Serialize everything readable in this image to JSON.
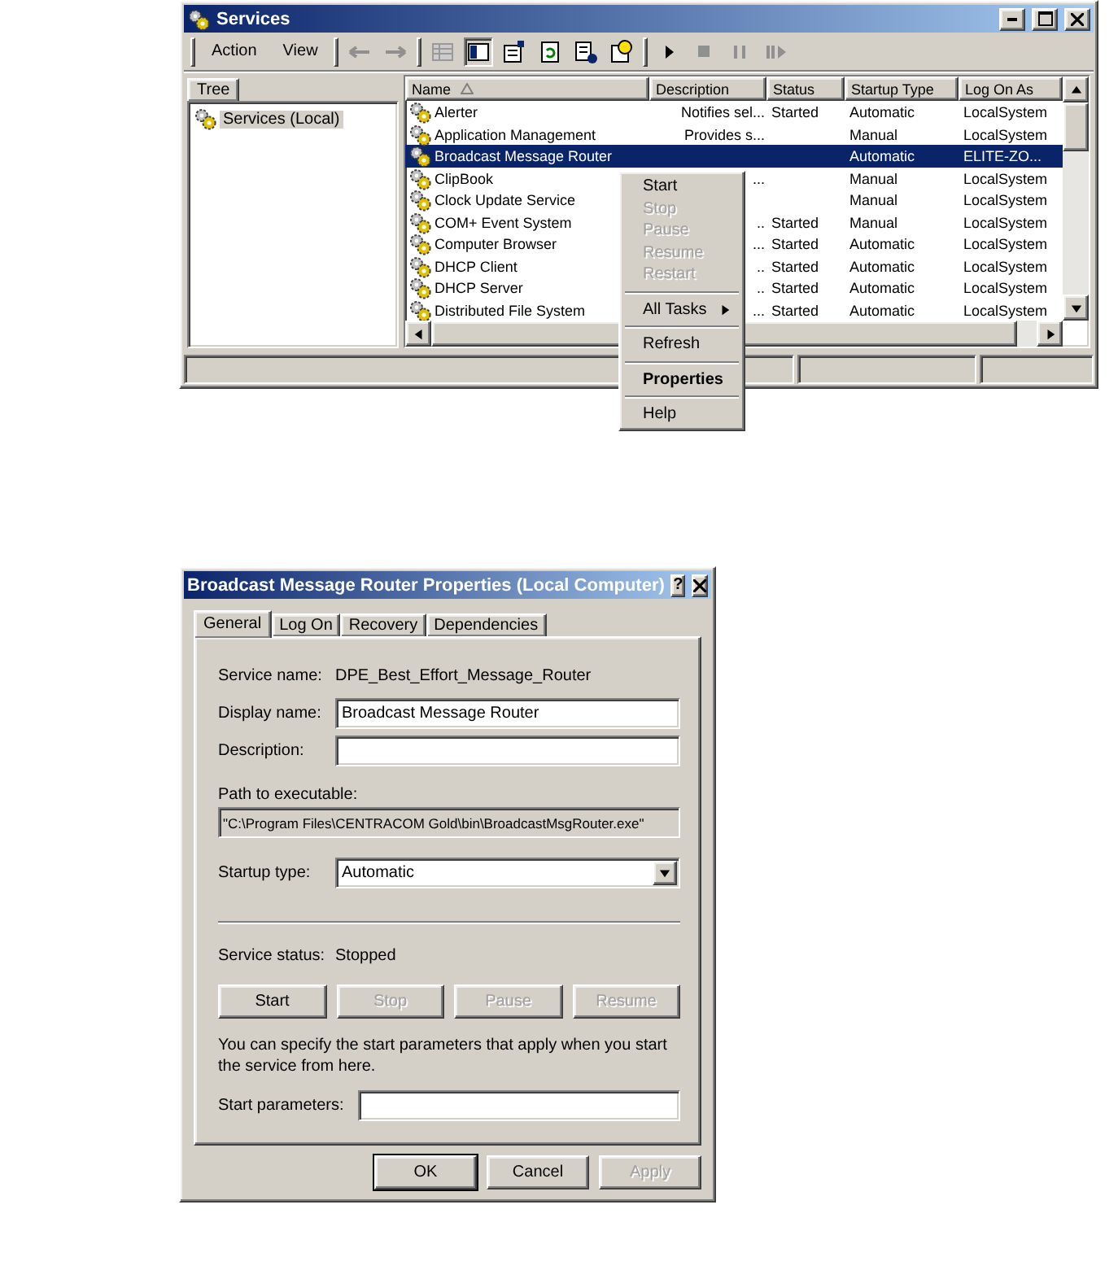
{
  "services_window": {
    "title": "Services",
    "menu": [
      "Action",
      "View"
    ],
    "tree_tab": "Tree",
    "tree_items": [
      {
        "label": "Services (Local)",
        "selected": true
      }
    ],
    "columns": [
      {
        "label": "Name",
        "sorted": true
      },
      {
        "label": "Description",
        "sorted": false
      },
      {
        "label": "Status",
        "sorted": false
      },
      {
        "label": "Startup Type",
        "sorted": false
      },
      {
        "label": "Log On As",
        "sorted": false
      }
    ],
    "rows": [
      {
        "name": "Alerter",
        "description": "Notifies sel...",
        "status": "Started",
        "startup_type": "Automatic",
        "log_on_as": "LocalSystem",
        "selected": false
      },
      {
        "name": "Application Management",
        "description": "Provides s...",
        "startup_type": "Manual",
        "log_on_as": "LocalSystem",
        "selected": false
      },
      {
        "name": "Broadcast Message Router",
        "startup_type": "Automatic",
        "log_on_as": "ELITE-ZO...",
        "selected": true
      },
      {
        "name": "ClipBook",
        "description": "...",
        "startup_type": "Manual",
        "log_on_as": "LocalSystem",
        "selected": false
      },
      {
        "name": "Clock Update Service",
        "startup_type": "Manual",
        "log_on_as": "LocalSystem",
        "selected": false
      },
      {
        "name": "COM+ Event System",
        "description": "..",
        "status": "Started",
        "startup_type": "Manual",
        "log_on_as": "LocalSystem",
        "selected": false
      },
      {
        "name": "Computer Browser",
        "description": "...",
        "status": "Started",
        "startup_type": "Automatic",
        "log_on_as": "LocalSystem",
        "selected": false
      },
      {
        "name": "DHCP Client",
        "description": "..",
        "status": "Started",
        "startup_type": "Automatic",
        "log_on_as": "LocalSystem",
        "selected": false
      },
      {
        "name": "DHCP Server",
        "description": "..",
        "status": "Started",
        "startup_type": "Automatic",
        "log_on_as": "LocalSystem",
        "selected": false
      },
      {
        "name": "Distributed File System",
        "description": "...",
        "status": "Started",
        "startup_type": "Automatic",
        "log_on_as": "LocalSystem",
        "selected": false
      }
    ],
    "context_menu": [
      {
        "kind": "item",
        "label": "Start",
        "disabled": false,
        "bold": false,
        "submenu": false
      },
      {
        "kind": "item",
        "label": "Stop",
        "disabled": true,
        "bold": false,
        "submenu": false
      },
      {
        "kind": "item",
        "label": "Pause",
        "disabled": true,
        "bold": false,
        "submenu": false
      },
      {
        "kind": "item",
        "label": "Resume",
        "disabled": true,
        "bold": false,
        "submenu": false
      },
      {
        "kind": "item",
        "label": "Restart",
        "disabled": true,
        "bold": false,
        "submenu": false
      },
      {
        "kind": "separator"
      },
      {
        "kind": "item",
        "label": "All Tasks",
        "disabled": false,
        "bold": false,
        "submenu": true
      },
      {
        "kind": "separator"
      },
      {
        "kind": "item",
        "label": "Refresh",
        "disabled": false,
        "bold": false,
        "submenu": false
      },
      {
        "kind": "separator"
      },
      {
        "kind": "item",
        "label": "Properties",
        "disabled": false,
        "bold": true,
        "submenu": false
      },
      {
        "kind": "separator"
      },
      {
        "kind": "item",
        "label": "Help",
        "disabled": false,
        "bold": false,
        "submenu": false
      }
    ]
  },
  "properties_dialog": {
    "title": "Broadcast Message Router Properties (Local Computer)",
    "help_button": "?",
    "tabs": [
      {
        "label": "General",
        "selected": true
      },
      {
        "label": "Log On",
        "selected": false
      },
      {
        "label": "Recovery",
        "selected": false
      },
      {
        "label": "Dependencies",
        "selected": false
      }
    ],
    "service_name": {
      "label": "Service name:",
      "value": "DPE_Best_Effort_Message_Router"
    },
    "display_name": {
      "label": "Display name:",
      "value": "Broadcast Message Router"
    },
    "description": {
      "label": "Description:"
    },
    "path": {
      "label": "Path to executable:",
      "value": "\"C:\\Program Files\\CENTRACOM Gold\\bin\\BroadcastMsgRouter.exe\""
    },
    "startup_type": {
      "label": "Startup type:",
      "value": "Automatic"
    },
    "service_status": {
      "label": "Service status:",
      "value": "Stopped"
    },
    "control_buttons": [
      {
        "label": "Start",
        "disabled": false
      },
      {
        "label": "Stop",
        "disabled": true
      },
      {
        "label": "Pause",
        "disabled": true
      },
      {
        "label": "Resume",
        "disabled": true
      }
    ],
    "hint": "You can specify the start parameters that apply when you start the service from here.",
    "start_parameters": {
      "label": "Start parameters:"
    },
    "buttons": [
      {
        "label": "OK",
        "disabled": false,
        "default": true
      },
      {
        "label": "Cancel",
        "disabled": false,
        "default": false
      },
      {
        "label": "Apply",
        "disabled": true,
        "default": false
      }
    ]
  }
}
